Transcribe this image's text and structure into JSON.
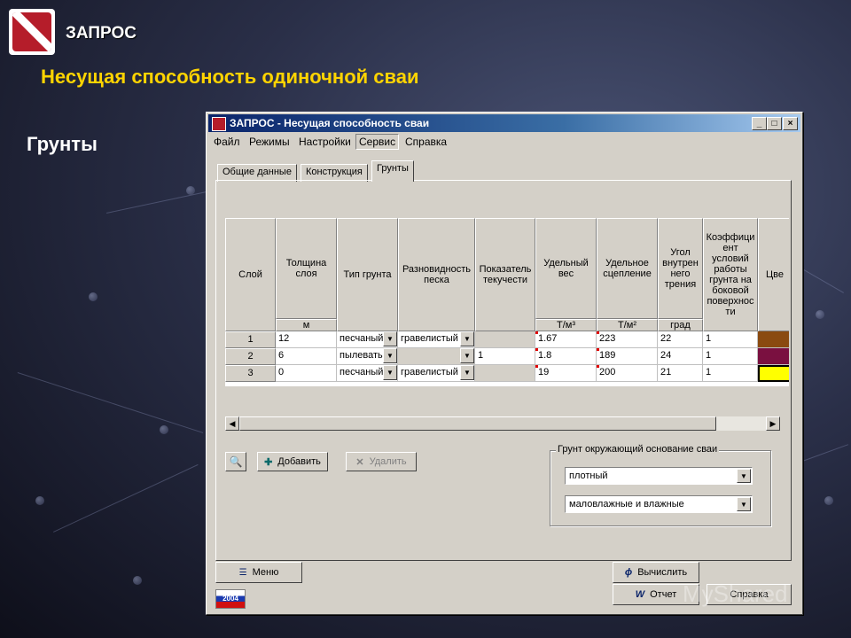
{
  "slide": {
    "brand": "ЗАПРОС",
    "title": "Несущая способность одиночной сваи",
    "section": "Грунты"
  },
  "window": {
    "title": "ЗАПРОС - Несущая способность сваи",
    "menu": [
      "Файл",
      "Режимы",
      "Настройки",
      "Сервис",
      "Справка"
    ],
    "tabs": [
      "Общие данные",
      "Конструкция",
      "Грунты"
    ],
    "active_tab": "Грунты"
  },
  "grid": {
    "headers": [
      "Слой",
      "Толщина слоя",
      "Тип грунта",
      "Разновидность песка",
      "Показатель текучести",
      "Удельный вес",
      "Удельное сцепление",
      "Угол внутрен него трения",
      "Коэффици ент условий работы грунта на боковой поверхнос ти",
      "Цве"
    ],
    "units": [
      "",
      "м",
      "",
      "",
      "",
      "Т/м³",
      "Т/м²",
      "град",
      "",
      ""
    ],
    "rows": [
      {
        "num": "1",
        "thickness": "12",
        "soil_type": "песчаный",
        "sand_kind": "гравелистый",
        "fluidity": "",
        "weight": "1.67",
        "cohesion": "223",
        "angle": "22",
        "coef": "1",
        "color": "#8a4a10"
      },
      {
        "num": "2",
        "thickness": "6",
        "soil_type": "пылеватый",
        "sand_kind": "",
        "fluidity": "1",
        "weight": "1.8",
        "cohesion": "189",
        "angle": "24",
        "coef": "1",
        "color": "#7a1040"
      },
      {
        "num": "3",
        "thickness": "0",
        "soil_type": "песчаный",
        "sand_kind": "гравелистый",
        "fluidity": "",
        "weight": "19",
        "cohesion": "200",
        "angle": "21",
        "coef": "1",
        "color": "#ffff00"
      }
    ]
  },
  "buttons": {
    "add": "Добавить",
    "delete": "Удалить",
    "menu": "Меню",
    "calculate": "Вычислить",
    "report": "Отчет",
    "help": "Справка"
  },
  "groupbox": {
    "legend": "Грунт окружающий основание сваи",
    "density": "плотный",
    "moisture": "маловлажные и влажные"
  },
  "badge_text": "2004",
  "watermark": "MyShared"
}
